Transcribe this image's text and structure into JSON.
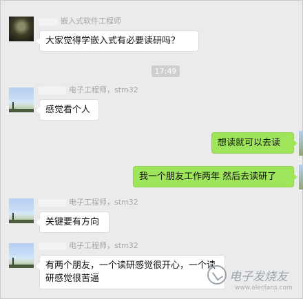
{
  "chat": {
    "messages": [
      {
        "sender": "嵌入式软件工程师",
        "text": "大家觉得学嵌入式有必要读研吗？"
      },
      {
        "time": "17:49"
      },
      {
        "sender": "电子工程师，stm32",
        "text": "感觉看个人"
      },
      {
        "text": "想读就可以去读",
        "self": true
      },
      {
        "text": "我一个朋友工作两年 然后去读研了",
        "self": true
      },
      {
        "sender": "电子工程师，stm32",
        "text": "关键要有方向"
      },
      {
        "sender": "电子工程师，stm32",
        "text": "有两个朋友，一个读研感觉很开心，一个读研感觉很苦逼"
      }
    ]
  },
  "watermark": {
    "name": "电子发烧友",
    "url": "www.elecfans.com"
  }
}
